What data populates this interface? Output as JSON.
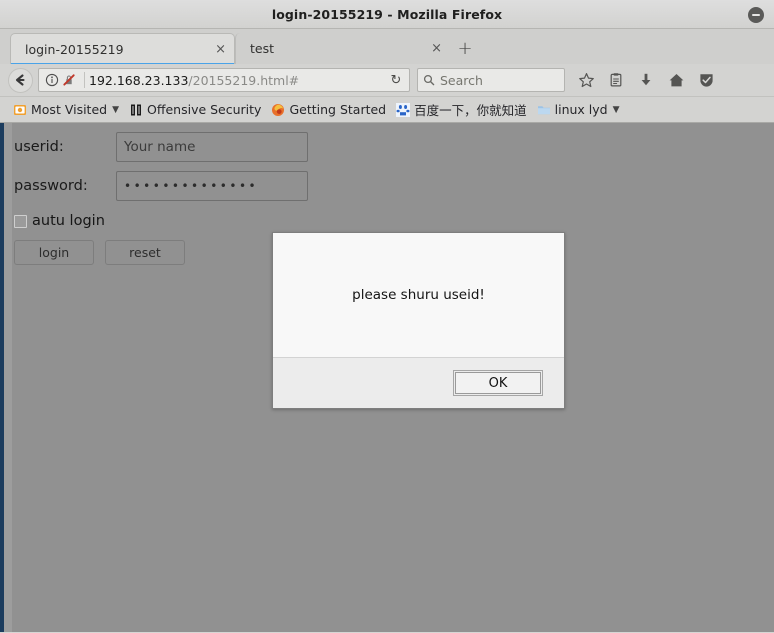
{
  "window": {
    "title": "login-20155219 - Mozilla Firefox",
    "minimize_label": "Minimize"
  },
  "tabs": [
    {
      "label": "login-20155219",
      "close": "×",
      "active": true
    },
    {
      "label": "test",
      "close": "×",
      "active": false
    }
  ],
  "newtab_label": "+",
  "navbar": {
    "back_glyph": "←",
    "url_host": "192.168.23.133",
    "url_path": "/20155219.html#",
    "reload_glyph": "↻",
    "search_placeholder": "Search",
    "icons": [
      "bookmark-star-icon",
      "library-icon",
      "downloads-icon",
      "home-icon",
      "shield-icon"
    ]
  },
  "bookmarks": [
    {
      "label": "Most Visited",
      "icon": "most-visited-icon",
      "has_caret": true
    },
    {
      "label": "Offensive Security",
      "icon": "offensive-security-icon",
      "has_caret": false
    },
    {
      "label": "Getting Started",
      "icon": "firefox-icon",
      "has_caret": false
    },
    {
      "label": "百度一下，你就知道",
      "icon": "baidu-icon",
      "has_caret": false
    },
    {
      "label": "linux lyd",
      "icon": "folder-icon",
      "has_caret": true
    }
  ],
  "page": {
    "userid_label": "userid:",
    "userid_placeholder": "Your name",
    "userid_value": "",
    "password_label": "password:",
    "password_value": "••••••••••••••",
    "autologin_label": "autu login",
    "login_button": "login",
    "reset_button": "reset"
  },
  "dialog": {
    "message": "please shuru useid!",
    "ok_label": "OK"
  },
  "colors": {
    "page_background": "#919191",
    "chrome_background": "#d3d3d1",
    "titlebar": "#d8d8d6",
    "active_tab": "#dddddb",
    "dialog_background": "#f8f8f8",
    "left_edge_accent": "#1c3c5e"
  }
}
